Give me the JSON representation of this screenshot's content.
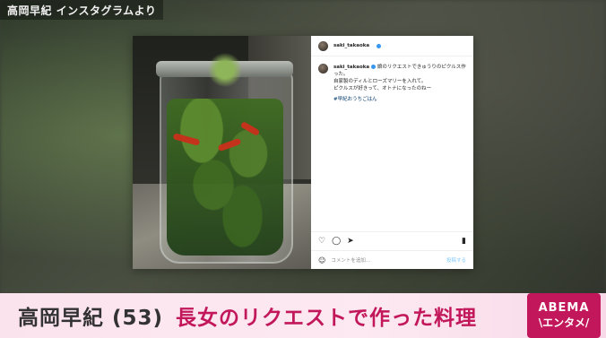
{
  "source_label": "高岡早紀 インスタグラムより",
  "post": {
    "username": "saki_takaoka",
    "caption_username": "saki_takaoka",
    "caption_lines": [
      "娘のリクエストできゅうりのピクルス作った。",
      "自家製のディルとローズマリーを入れて。",
      "ピクルスが好きって、オトナになったのねー"
    ],
    "hashtag": "#早紀おうちごはん",
    "comment_placeholder": "コメントを追加...",
    "post_button": "投稿する",
    "icons": [
      "heart-icon",
      "comment-icon",
      "share-icon",
      "bookmark-icon",
      "smile-icon"
    ]
  },
  "lower_third": {
    "name": "高岡早紀 (53)",
    "subtitle": "長女のリクエストで作った料理"
  },
  "logo": {
    "line1": "ABEMA",
    "line2": "\\エンタメ/"
  },
  "colors": {
    "accent": "#c2185b",
    "link": "#00376b",
    "verified": "#3897f0"
  }
}
